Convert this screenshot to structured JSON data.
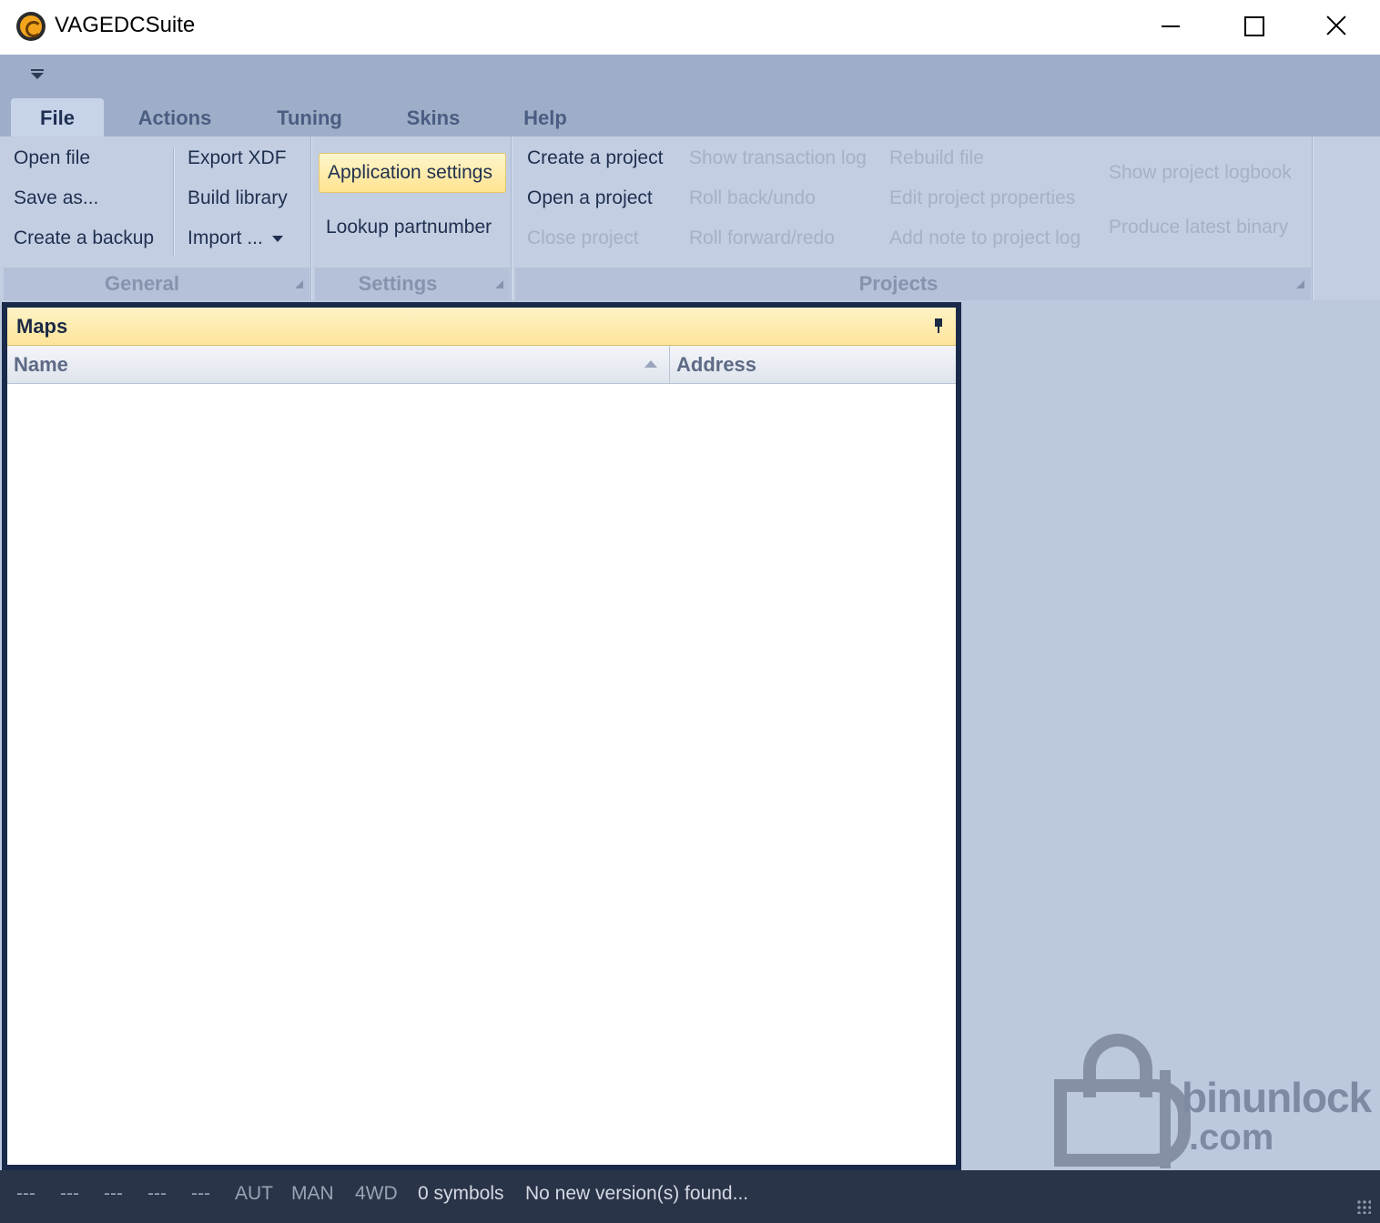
{
  "window": {
    "title": "VAGEDCSuite"
  },
  "tabs": [
    {
      "label": "File"
    },
    {
      "label": "Actions"
    },
    {
      "label": "Tuning"
    },
    {
      "label": "Skins"
    },
    {
      "label": "Help"
    }
  ],
  "ribbon": {
    "general": {
      "caption": "General",
      "open_file": "Open file",
      "save_as": "Save as...",
      "create_backup": "Create a backup",
      "export_xdf": "Export XDF",
      "build_library": "Build library",
      "import": "Import ..."
    },
    "settings": {
      "caption": "Settings",
      "application_settings": "Application settings",
      "lookup_partnumber": "Lookup partnumber"
    },
    "projects": {
      "caption": "Projects",
      "create_project": "Create a project",
      "open_project": "Open a project",
      "close_project": "Close project",
      "show_transaction_log": "Show transaction log",
      "roll_back": "Roll back/undo",
      "roll_forward": "Roll forward/redo",
      "rebuild_file": "Rebuild file",
      "edit_project_properties": "Edit project properties",
      "add_note": "Add note to project log",
      "show_logbook": "Show project logbook",
      "produce_binary": "Produce latest binary"
    }
  },
  "maps_panel": {
    "title": "Maps",
    "columns": [
      "Name",
      "Address"
    ],
    "rows": []
  },
  "watermark": {
    "line1": "binunlock",
    "line2": ".com"
  },
  "statusbar": {
    "fields": [
      "---",
      "---",
      "---",
      "---",
      "---"
    ],
    "aut": "AUT",
    "man": "MAN",
    "fourwd": "4WD",
    "symbols": "0 symbols",
    "version": "No new version(s) found..."
  }
}
